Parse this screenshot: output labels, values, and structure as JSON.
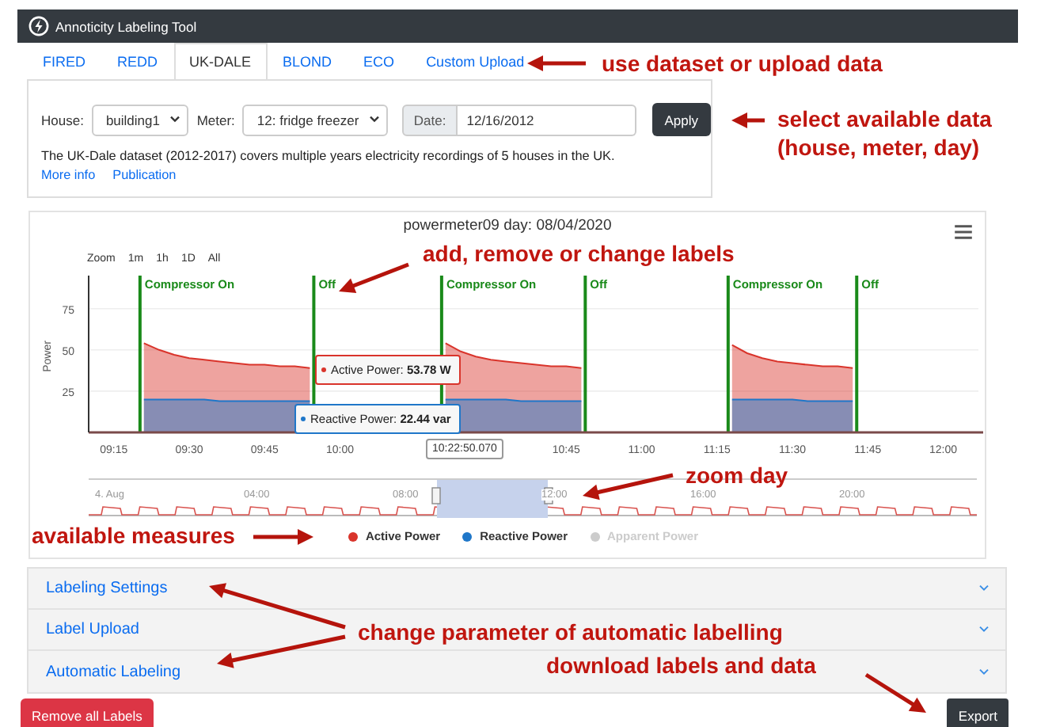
{
  "navbar": {
    "title": "Annoticity Labeling Tool"
  },
  "tabs": [
    {
      "label": "FIRED",
      "selected": false
    },
    {
      "label": "REDD",
      "selected": false
    },
    {
      "label": "UK-DALE",
      "selected": true
    },
    {
      "label": "BLOND",
      "selected": false
    },
    {
      "label": "ECO",
      "selected": false
    },
    {
      "label": "Custom Upload",
      "selected": false
    }
  ],
  "selection": {
    "house_label": "House:",
    "house": "building1",
    "meter_label": "Meter:",
    "meter": "12: fridge freezer",
    "date_label": "Date:",
    "date": "12/16/2012",
    "apply": "Apply",
    "description": "The UK-Dale dataset (2012-2017) covers multiple years electricity recordings of 5 houses in the UK.",
    "links": [
      "More info",
      "Publication"
    ]
  },
  "chart": {
    "title": "powermeter09 day: 08/04/2020",
    "zoom_label": "Zoom",
    "zoom_buttons": [
      "1m",
      "1h",
      "1D",
      "All"
    ],
    "chart_data": {
      "type": "area",
      "ylabel": "Power",
      "categories": [
        null,
        "09:15",
        null,
        null,
        null,
        null,
        "09:30",
        null,
        null,
        null,
        null,
        "09:45",
        null,
        null,
        null,
        null,
        "10:00",
        null,
        null,
        null,
        null,
        null,
        null,
        null,
        null,
        null,
        null,
        null,
        null,
        null,
        null,
        "10:45",
        null,
        null,
        null,
        null,
        "11:00",
        null,
        null,
        null,
        null,
        "11:15",
        null,
        null,
        null,
        null,
        "11:30",
        null,
        null,
        null,
        null,
        "11:45",
        null,
        null,
        null,
        null,
        "12:00",
        null,
        null
      ],
      "series": [
        {
          "name": "Active Power",
          "color": "#d9342b",
          "values": [
            null,
            null,
            null,
            54,
            50,
            47,
            45,
            44,
            43,
            42,
            41,
            41,
            40,
            40,
            39,
            null,
            null,
            null,
            null,
            null,
            null,
            null,
            null,
            54,
            49,
            46,
            44,
            43,
            42,
            41,
            40,
            40,
            39,
            null,
            null,
            null,
            null,
            null,
            null,
            null,
            null,
            null,
            53,
            48,
            45,
            43,
            42,
            41,
            40,
            40,
            39,
            null,
            null,
            null,
            null,
            null,
            null,
            null,
            null
          ]
        },
        {
          "name": "Reactive Power",
          "color": "#1f77c9",
          "values": [
            null,
            null,
            null,
            20,
            20,
            20,
            20,
            20,
            19,
            19,
            19,
            19,
            19,
            19,
            19,
            null,
            null,
            null,
            null,
            null,
            null,
            null,
            null,
            20,
            20,
            20,
            20,
            20,
            19,
            19,
            19,
            19,
            19,
            null,
            null,
            null,
            null,
            null,
            null,
            null,
            null,
            null,
            20,
            20,
            20,
            20,
            20,
            19,
            19,
            19,
            19,
            null,
            null,
            null,
            null,
            null,
            null,
            null,
            null
          ]
        }
      ],
      "ylim": [
        0,
        95
      ],
      "yticks": [
        25,
        50,
        75
      ],
      "grid": true
    },
    "labels": [
      "Compressor On",
      "Off",
      "Compressor On",
      "Off",
      "Compressor On",
      "Off"
    ],
    "tooltips": [
      {
        "kind": "active",
        "text": "Active Power: **53.78 W**",
        "color": "#d9342b"
      },
      {
        "kind": "reactive",
        "text": "Reactive Power: **22.44 var**",
        "color": "#1f77c9"
      }
    ],
    "crosshair_label": "10:22:50.070",
    "navigator": {
      "labels": [
        "4. Aug",
        "04:00",
        "08:00",
        "12:00",
        "16:00",
        "20:00"
      ]
    },
    "legend": [
      {
        "enabled": true
      },
      {
        "enabled": true
      },
      {
        "label": "Apparent Power",
        "color": "#cccccc",
        "enabled": false
      }
    ]
  },
  "accordion": [
    {
      "label": "Labeling Settings",
      "expanded": false
    },
    {
      "label": "Label Upload",
      "expanded": false
    },
    {
      "label": "Automatic Labeling",
      "expanded": false
    }
  ],
  "buttons": {
    "remove": "Remove all Labels",
    "export": "Export"
  },
  "annotations": [
    {
      "text": "use dataset or upload data"
    },
    {
      "text": "select available data (house, meter, day)"
    },
    {
      "text": "add, remove or change labels"
    },
    {
      "text": "zoom day"
    },
    {
      "text": "available measures"
    },
    {
      "text": "change parameter of automatic labelling"
    },
    {
      "text": "download labels and data"
    }
  ]
}
